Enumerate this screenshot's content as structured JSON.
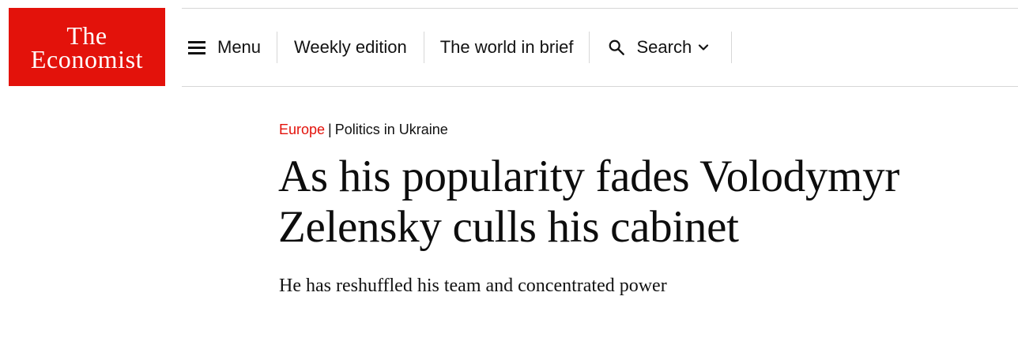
{
  "brand": {
    "logo_line1": "The",
    "logo_line2": "Economist",
    "color": "#e3120b"
  },
  "nav": {
    "menu_label": "Menu",
    "weekly_label": "Weekly edition",
    "brief_label": "The world in brief",
    "search_label": "Search",
    "icons": {
      "menu": "hamburger-icon",
      "search": "search-icon",
      "dropdown": "chevron-down-icon"
    }
  },
  "article": {
    "section": "Europe",
    "separator": "|",
    "flytitle": "Politics in Ukraine",
    "headline": "As his popularity fades Volodymyr Zelensky culls his cabinet",
    "standfirst": "He has reshuffled his team and concentrated power"
  }
}
